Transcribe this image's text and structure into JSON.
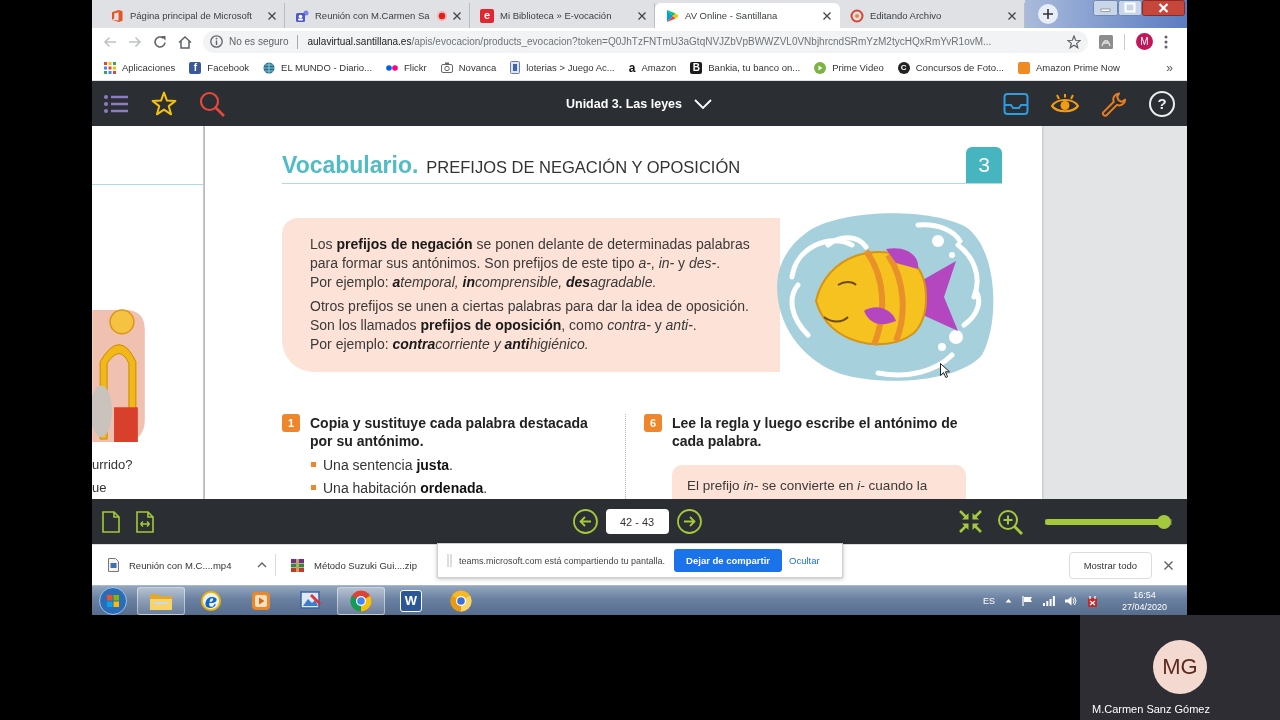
{
  "browser": {
    "tabs": [
      {
        "title": "Página principal de Microsoft",
        "kind": "office",
        "selected": false,
        "recording": false
      },
      {
        "title": "Reunión con M.Carmen Sa",
        "kind": "teams",
        "selected": false,
        "recording": true
      },
      {
        "title": "Mi Biblioteca » E-vocación",
        "kind": "letter",
        "letter": "e",
        "selected": false,
        "recording": false
      },
      {
        "title": "AV Online - Santillana",
        "kind": "play",
        "selected": true,
        "recording": false
      },
      {
        "title": "Editando Archivo",
        "kind": "ring",
        "selected": false,
        "recording": false
      }
    ],
    "address": {
      "security": "No es seguro",
      "host": "aulavirtual.santillana.es",
      "path": "/apis/evocacion/products_evocacion?token=Q0JhTzFNTmU3aGtqNVJZbVpBWWZVL0VNbjhrcndSRmYzM2tycHQxRmYvR1ovM..."
    },
    "profile": "M",
    "bookmarks": [
      {
        "label": "Aplicaciones",
        "kind": "grid"
      },
      {
        "label": "Facebook",
        "kind": "tile",
        "letter": "f",
        "color": "#3b5998"
      },
      {
        "label": "EL MUNDO - Diario...",
        "kind": "globe"
      },
      {
        "label": "Flickr",
        "kind": "dots"
      },
      {
        "label": "Novanca",
        "kind": "camera"
      },
      {
        "label": "loterias > Juego Ac...",
        "kind": "card"
      },
      {
        "label": "Amazon",
        "kind": "glyph",
        "letter": "a"
      },
      {
        "label": "Bankia, tu banco on...",
        "kind": "tile",
        "letter": "B",
        "color": "#1c1c1c"
      },
      {
        "label": "Prime Video",
        "kind": "play-circle"
      },
      {
        "label": "Concursos de Foto...",
        "kind": "disc",
        "letter": "C"
      },
      {
        "label": "Amazon Prime Now",
        "kind": "tile",
        "color": "#f08a24"
      }
    ],
    "more": "»"
  },
  "app_bar": {
    "title": "Unidad 3. Las leyes",
    "help": "?"
  },
  "reader": {
    "left_page": {
      "lines": [
        "urrido?",
        "ue"
      ]
    },
    "heading": {
      "lead": "Vocabulario.",
      "title": "PREFIJOS DE NEGACIÓN Y OPOSICIÓN",
      "number": "3"
    },
    "info_box": {
      "lines": [
        {
          "kind": "plain",
          "text": "Los **prefijos de negación** se ponen delante de determinadas palabras para formar sus antónimos. Son prefijos de este tipo *a-*, *in-* y *des-*."
        },
        {
          "kind": "example",
          "lead": "Por ejemplo:",
          "text": "**a**temporal, **in**comprensible, **des**agradable."
        },
        {
          "kind": "plain",
          "text": "Otros prefijos se unen a ciertas palabras para dar la idea de oposición. Son los llamados **prefijos de oposición**, como *contra-* y *anti-*."
        },
        {
          "kind": "example",
          "lead": "Por ejemplo:",
          "text": "**contra**corriente y **anti**higiénico."
        }
      ]
    },
    "exercises": [
      {
        "number": "1",
        "prompt": "Copia y sustituye cada palabra destacada por su antónimo.",
        "items": [
          "Una sentencia **justa**.",
          "Una habitación **ordenada**."
        ]
      },
      {
        "number": "6",
        "prompt": "Lee la regla y luego escribe el antónimo de cada palabra.",
        "rule": "El prefijo *in-* se convierte en *i-* cuando la"
      }
    ]
  },
  "reader_footer": {
    "pages": "42 - 43",
    "zoom": {
      "level": 0.94
    }
  },
  "downloads": {
    "items": [
      {
        "name": "Reunión con M.C....mp4",
        "kind": "video",
        "caret": true
      },
      {
        "name": "Método Suzuki Gui....zip",
        "kind": "archive",
        "caret": false
      }
    ],
    "show_all": "Mostrar todo"
  },
  "share_notice": {
    "message": "teams.microsoft.com está compartiendo tu pantalla.",
    "stop": "Dejar de compartir",
    "hide": "Ocultar"
  },
  "taskbar": {
    "apps": [
      {
        "kind": "explorer",
        "running": true
      },
      {
        "kind": "ie",
        "letter": "e",
        "running": false
      },
      {
        "kind": "media",
        "running": false
      },
      {
        "kind": "paint",
        "running": false
      },
      {
        "kind": "chrome",
        "running": true
      },
      {
        "kind": "word",
        "letter": "W",
        "running": false
      },
      {
        "kind": "canary",
        "running": false
      }
    ],
    "language": "ES",
    "time": "16:54",
    "date": "27/04/2020"
  },
  "participant": {
    "initials": "MG",
    "name": "M.Carmen Sanz Gómez"
  }
}
